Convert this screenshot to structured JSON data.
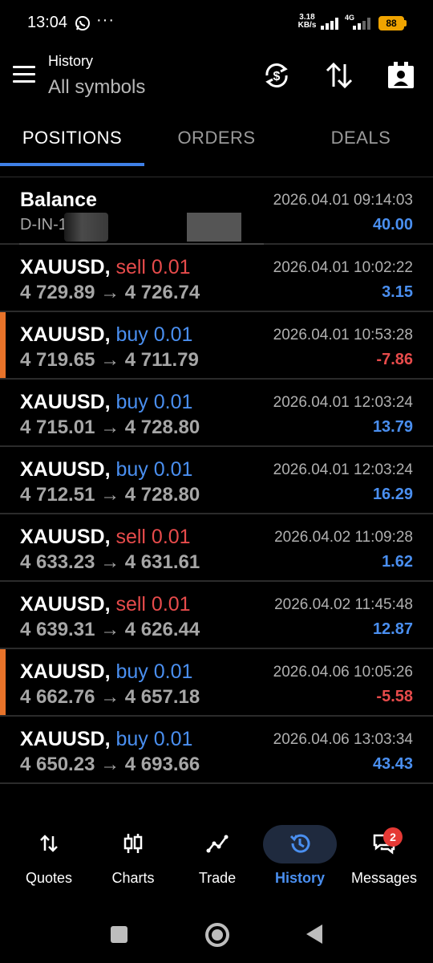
{
  "status": {
    "time": "13:04",
    "more": "···",
    "net_speed_value": "3.18",
    "net_speed_unit": "KB/s",
    "net_type": "4G",
    "battery": "88"
  },
  "header": {
    "title": "History",
    "subtitle": "All symbols"
  },
  "tabs": [
    {
      "label": "POSITIONS",
      "active": true
    },
    {
      "label": "ORDERS",
      "active": false
    },
    {
      "label": "DEALS",
      "active": false
    }
  ],
  "balance_row": {
    "title": "Balance",
    "account_prefix": "D-IN-1",
    "date": "2026.04.01 09:14:03",
    "amount": "40.00"
  },
  "deals": [
    {
      "symbol": "XAUUSD,",
      "type": "sell 0.01",
      "direction": "sell",
      "open": "4 729.89",
      "arrow": "→",
      "close": "4 726.74",
      "date": "2026.04.01 10:02:22",
      "profit": "3.15",
      "loss": false
    },
    {
      "symbol": "XAUUSD,",
      "type": "buy 0.01",
      "direction": "buy",
      "open": "4 719.65",
      "arrow": "→",
      "close": "4 711.79",
      "date": "2026.04.01 10:53:28",
      "profit": "-7.86",
      "loss": true
    },
    {
      "symbol": "XAUUSD,",
      "type": "buy 0.01",
      "direction": "buy",
      "open": "4 715.01",
      "arrow": "→",
      "close": "4 728.80",
      "date": "2026.04.01 12:03:24",
      "profit": "13.79",
      "loss": false
    },
    {
      "symbol": "XAUUSD,",
      "type": "buy 0.01",
      "direction": "buy",
      "open": "4 712.51",
      "arrow": "→",
      "close": "4 728.80",
      "date": "2026.04.01 12:03:24",
      "profit": "16.29",
      "loss": false
    },
    {
      "symbol": "XAUUSD,",
      "type": "sell 0.01",
      "direction": "sell",
      "open": "4 633.23",
      "arrow": "→",
      "close": "4 631.61",
      "date": "2026.04.02 11:09:28",
      "profit": "1.62",
      "loss": false
    },
    {
      "symbol": "XAUUSD,",
      "type": "sell 0.01",
      "direction": "sell",
      "open": "4 639.31",
      "arrow": "→",
      "close": "4 626.44",
      "date": "2026.04.02 11:45:48",
      "profit": "12.87",
      "loss": false
    },
    {
      "symbol": "XAUUSD,",
      "type": "buy 0.01",
      "direction": "buy",
      "open": "4 662.76",
      "arrow": "→",
      "close": "4 657.18",
      "date": "2026.04.06 10:05:26",
      "profit": "-5.58",
      "loss": true
    },
    {
      "symbol": "XAUUSD,",
      "type": "buy 0.01",
      "direction": "buy",
      "open": "4 650.23",
      "arrow": "→",
      "close": "4 693.66",
      "date": "2026.04.06 13:03:34",
      "profit": "43.43",
      "loss": false
    }
  ],
  "bottom_nav": [
    {
      "label": "Quotes",
      "icon": "quotes-arrows-icon",
      "active": false
    },
    {
      "label": "Charts",
      "icon": "candlestick-icon",
      "active": false
    },
    {
      "label": "Trade",
      "icon": "trend-line-icon",
      "active": false
    },
    {
      "label": "History",
      "icon": "history-clock-icon",
      "active": true
    },
    {
      "label": "Messages",
      "icon": "chat-bubbles-icon",
      "active": false
    }
  ],
  "messages_badge": "2",
  "colors": {
    "accent": "#4a8ff0",
    "sell": "#e74b4b",
    "loss_marker": "#e8732a",
    "battery": "#f0a400"
  },
  "header_icons": [
    "currency-sync-icon",
    "sort-arrows-icon",
    "account-badge-icon"
  ]
}
